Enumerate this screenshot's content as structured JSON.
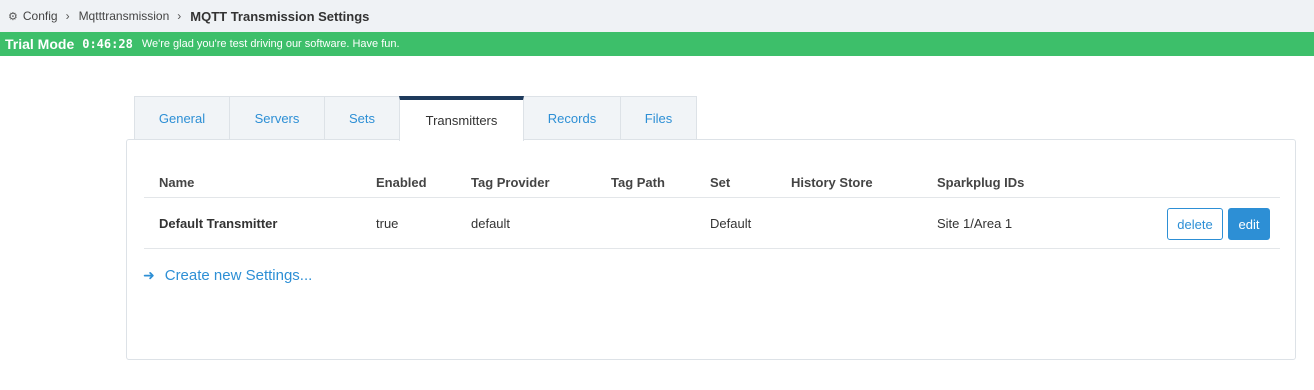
{
  "breadcrumb": {
    "items": [
      {
        "icon": "gear-icon",
        "label": "Config"
      },
      {
        "label": "Mqtttransmission"
      }
    ],
    "current": "MQTT Transmission Settings"
  },
  "trial": {
    "title": "Trial Mode",
    "timer": "0:46:28",
    "message": "We're glad you're test driving our software. Have fun."
  },
  "tabs": [
    {
      "label": "General",
      "active": false
    },
    {
      "label": "Servers",
      "active": false
    },
    {
      "label": "Sets",
      "active": false
    },
    {
      "label": "Transmitters",
      "active": true
    },
    {
      "label": "Records",
      "active": false
    },
    {
      "label": "Files",
      "active": false
    }
  ],
  "table": {
    "headers": {
      "name": "Name",
      "enabled": "Enabled",
      "tag_provider": "Tag Provider",
      "tag_path": "Tag Path",
      "set": "Set",
      "history_store": "History Store",
      "sparkplug_ids": "Sparkplug IDs"
    },
    "rows": [
      {
        "name": "Default Transmitter",
        "enabled": "true",
        "tag_provider": "default",
        "tag_path": "",
        "set": "Default",
        "history_store": "",
        "sparkplug_ids": "Site 1/Area 1",
        "delete_label": "delete",
        "edit_label": "edit"
      }
    ]
  },
  "create_link": {
    "icon": "arrow-right-icon",
    "label": "Create new Settings..."
  },
  "colors": {
    "accent": "#2d8fd5",
    "trial_green": "#3dbf6a",
    "active_tab_border": "#1e3a5c",
    "breadcrumb_bg": "#eff2f5"
  }
}
